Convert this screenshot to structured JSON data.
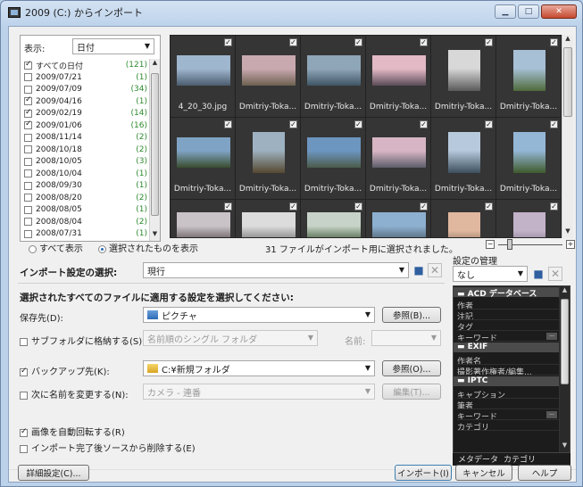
{
  "window": {
    "title": "2009 (C:) からインポート"
  },
  "view": {
    "label": "表示:",
    "value": "日付"
  },
  "dates": [
    {
      "label": "すべての日付",
      "count": "(121)",
      "checked": true
    },
    {
      "label": "2009/07/21",
      "count": "(1)",
      "checked": false
    },
    {
      "label": "2009/07/09",
      "count": "(34)",
      "checked": false
    },
    {
      "label": "2009/04/16",
      "count": "(1)",
      "checked": true
    },
    {
      "label": "2009/02/19",
      "count": "(14)",
      "checked": true
    },
    {
      "label": "2009/01/06",
      "count": "(16)",
      "checked": true
    },
    {
      "label": "2008/11/14",
      "count": "(2)",
      "checked": false
    },
    {
      "label": "2008/10/18",
      "count": "(2)",
      "checked": false
    },
    {
      "label": "2008/10/05",
      "count": "(3)",
      "checked": false
    },
    {
      "label": "2008/10/04",
      "count": "(1)",
      "checked": false
    },
    {
      "label": "2008/09/30",
      "count": "(1)",
      "checked": false
    },
    {
      "label": "2008/08/20",
      "count": "(2)",
      "checked": false
    },
    {
      "label": "2008/08/05",
      "count": "(1)",
      "checked": false
    },
    {
      "label": "2008/08/04",
      "count": "(2)",
      "checked": false
    },
    {
      "label": "2008/07/31",
      "count": "(1)",
      "checked": false
    }
  ],
  "thumbnails": [
    {
      "caption": "4_20_30.jpg",
      "colors": [
        "#9fb6cf",
        "#4b5d6e"
      ]
    },
    {
      "caption": "Dmitriy-Toka...",
      "colors": [
        "#c9a9b0",
        "#6d6050"
      ]
    },
    {
      "caption": "Dmitriy-Toka...",
      "colors": [
        "#8fa6b8",
        "#3f5565"
      ]
    },
    {
      "caption": "Dmitriy-Toka...",
      "colors": [
        "#e2b9c5",
        "#5b4c58"
      ]
    },
    {
      "caption": "Dmitriy-Toka...",
      "colors": [
        "#d8d8d8",
        "#5a5a5a"
      ]
    },
    {
      "caption": "Dmitriy-Toka...",
      "colors": [
        "#a7c0d6",
        "#4e6a3a"
      ]
    },
    {
      "caption": "Dmitriy-Toka...",
      "colors": [
        "#7fa3c4",
        "#3a4d2e"
      ]
    },
    {
      "caption": "Dmitriy-Toka...",
      "colors": [
        "#9db1c0",
        "#56482f"
      ]
    },
    {
      "caption": "Dmitriy-Toka...",
      "colors": [
        "#6c95bf",
        "#4b5b4a"
      ]
    },
    {
      "caption": "Dmitriy-Toka...",
      "colors": [
        "#d7b5c4",
        "#5d5d6a"
      ]
    },
    {
      "caption": "Dmitriy-Toka...",
      "colors": [
        "#b7cadd",
        "#3d4f5d"
      ]
    },
    {
      "caption": "Dmitriy-Toka...",
      "colors": [
        "#94b7d6",
        "#3f5a2c"
      ]
    },
    {
      "caption": "",
      "colors": [
        "#c9c2c7",
        "#5c5254"
      ]
    },
    {
      "caption": "",
      "colors": [
        "#dcdcdc",
        "#777777"
      ]
    },
    {
      "caption": "",
      "colors": [
        "#c7d3c8",
        "#3f5a38"
      ]
    },
    {
      "caption": "",
      "colors": [
        "#8db0d0",
        "#4a5e6b"
      ]
    },
    {
      "caption": "",
      "colors": [
        "#e0b89f",
        "#5a4a3c"
      ]
    },
    {
      "caption": "",
      "colors": [
        "#c3b3c9",
        "#5b556b"
      ]
    }
  ],
  "filter": {
    "show_all": "すべて表示",
    "show_selected": "選択されたものを表示",
    "status": "31 ファイルがインポート用に選択されました。"
  },
  "settings_mgmt": {
    "label": "設定の管理",
    "value": "なし"
  },
  "import_settings": {
    "label": "インポート設定の選択:",
    "value": "現行"
  },
  "apply_heading": "選択されたすべてのファイルに適用する設定を選択してください:",
  "destination": {
    "label": "保存先(D):",
    "value": "ピクチャ",
    "browse": "参照(B)..."
  },
  "subfolder": {
    "label": "サブフォルダに格納する(S):",
    "value": "名前順のシングル フォルダ",
    "name_label": "名前:",
    "name_value": ""
  },
  "backup": {
    "label": "バックアップ先(K):",
    "value": "C:¥新規フォルダ",
    "browse": "参照(O)..."
  },
  "rename": {
    "label": "次に名前を変更する(N):",
    "value": "カメラ - 連番",
    "edit": "編集(T)..."
  },
  "auto_rotate": "画像を自動回転する(R)",
  "delete_after": "インポート完了後ソースから削除する(E)",
  "metadata": {
    "sections": [
      {
        "title": "ACD データベース",
        "rows": [
          "作者",
          "注記",
          "タグ",
          "キーワード"
        ]
      },
      {
        "title": "EXIF",
        "rows": [
          "作者名",
          "撮影著作権者/編集..."
        ]
      },
      {
        "title": "IPTC",
        "rows": [
          "キャプション",
          "筆者",
          "キーワード",
          "カテゴリ"
        ]
      }
    ],
    "tabs": [
      "メタデータ",
      "カテゴリ"
    ]
  },
  "buttons": {
    "advanced": "詳細設定(C)...",
    "import": "インポート(I)",
    "cancel": "キャンセル",
    "help": "ヘルプ"
  }
}
